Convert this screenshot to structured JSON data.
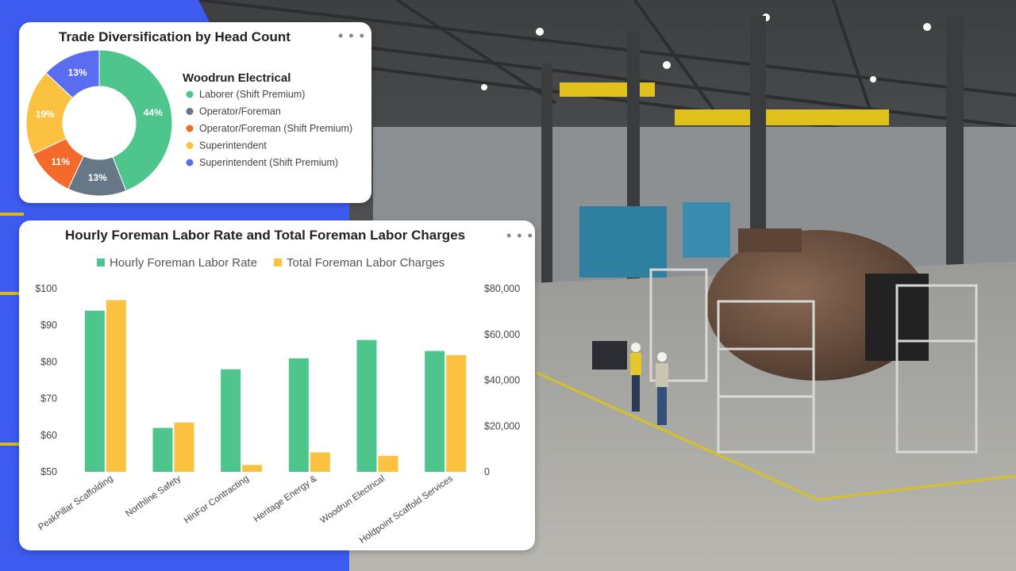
{
  "donut_card": {
    "title": "Trade Diversification by Head Count",
    "legend_heading": "Woodrun Electrical",
    "menu_icon": "more-horizontal-icon"
  },
  "bar_card": {
    "title": "Hourly Foreman Labor Rate and Total Foreman Labor Charges",
    "menu_icon": "more-horizontal-icon"
  },
  "colors": {
    "green": "#4fc58e",
    "slate": "#667786",
    "orange": "#f46a2a",
    "yellow": "#fbc242",
    "blue": "#5a6cf0",
    "bar_green": "#4fc58e",
    "bar_yellow": "#fbc242"
  },
  "chart_data": [
    {
      "type": "pie",
      "donut": true,
      "title": "Trade Diversification by Head Count",
      "legend_title": "Woodrun Electrical",
      "legend_position": "right",
      "slices": [
        {
          "label": "Laborer (Shift Premium)",
          "value": 44,
          "display": "44%",
          "color": "#4fc58e"
        },
        {
          "label": "Operator/Foreman",
          "value": 13,
          "display": "13%",
          "color": "#667786"
        },
        {
          "label": "Operator/Foreman (Shift Premium)",
          "value": 11,
          "display": "11%",
          "color": "#f46a2a"
        },
        {
          "label": "Superintendent",
          "value": 19,
          "display": "19%",
          "color": "#fbc242"
        },
        {
          "label": "Superintendent (Shift Premium)",
          "value": 13,
          "display": "13%",
          "color": "#5a6cf0"
        }
      ]
    },
    {
      "type": "bar",
      "title": "Hourly Foreman Labor Rate and Total Foreman Labor Charges",
      "legend_position": "top",
      "categories": [
        "PeakPillar Scaffolding",
        "Northline Safety",
        "HinFor Contracting",
        "Heritage Energy &",
        "Woodrun Electrical",
        "Holdpoint Scaffold Services"
      ],
      "series": [
        {
          "name": "Hourly Foreman Labor Rate",
          "axis": "left",
          "color": "#4fc58e",
          "values": [
            94,
            62,
            78,
            81,
            86,
            83
          ]
        },
        {
          "name": "Total Foreman Labor Charges",
          "axis": "right",
          "color": "#fbc242",
          "values": [
            75000,
            21500,
            3000,
            8500,
            7000,
            51000
          ]
        }
      ],
      "y_left": {
        "min": 50,
        "max": 100,
        "ticks": [
          50,
          60,
          70,
          80,
          90,
          100
        ],
        "tick_labels": [
          "$50",
          "$60",
          "$70",
          "$80",
          "$90",
          "$100"
        ]
      },
      "y_right": {
        "min": 0,
        "max": 80000,
        "ticks": [
          0,
          20000,
          40000,
          60000,
          80000
        ],
        "tick_labels": [
          "0",
          "$20,000",
          "$40,000",
          "$60,000",
          "$80,000"
        ]
      },
      "grid": false
    }
  ]
}
